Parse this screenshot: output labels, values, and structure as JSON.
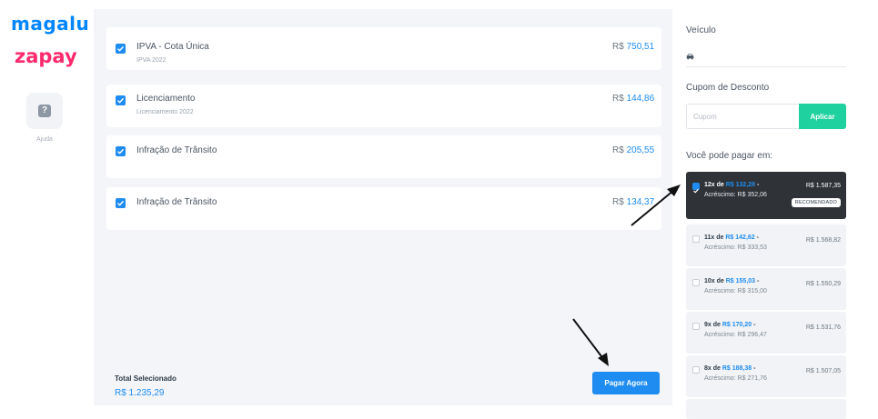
{
  "brand": {
    "magalu": "magalu",
    "zapay": "zapay",
    "magalu_color": "#0086ff",
    "zapay_color": "#ff2a6d"
  },
  "help": {
    "icon": "question-icon",
    "label": "Ajuda"
  },
  "debts": [
    {
      "title": "IPVA - Cota Única",
      "subtitle": "IPVA 2022",
      "currency": "R$",
      "amount": "750,51",
      "checked": true
    },
    {
      "title": "Licenciamento",
      "subtitle": "Licenciamento 2022",
      "currency": "R$",
      "amount": "144,86",
      "checked": true
    },
    {
      "title": "Infração de Trânsito",
      "subtitle": "",
      "currency": "R$",
      "amount": "205,55",
      "checked": true
    },
    {
      "title": "Infração de Trânsito",
      "subtitle": "",
      "currency": "R$",
      "amount": "134,37",
      "checked": true
    }
  ],
  "total": {
    "label": "Total Selecionado",
    "value": "R$ 1.235,29"
  },
  "pay_button": "Pagar Agora",
  "vehicle": {
    "label": "Veículo",
    "icon": "car-icon"
  },
  "coupon": {
    "label": "Cupom de Desconto",
    "placeholder": "Cupom",
    "button": "Aplicar"
  },
  "installments_label": "Você pode pagar em:",
  "installments": [
    {
      "prefix": "12x de",
      "value": "R$ 132,28",
      "suffix": " -",
      "extra": "Acréscimo: R$ 352,06",
      "total": "R$ 1.587,35",
      "selected": true,
      "badge": "RECOMENDADO"
    },
    {
      "prefix": "11x de",
      "value": "R$ 142,62",
      "suffix": " -",
      "extra": "Acréscimo: R$ 333,53",
      "total": "R$ 1.568,82",
      "selected": false
    },
    {
      "prefix": "10x de",
      "value": "R$ 155,03",
      "suffix": " -",
      "extra": "Acréscimo: R$ 315,00",
      "total": "R$ 1.550,29",
      "selected": false
    },
    {
      "prefix": "9x de",
      "value": "R$ 170,20",
      "suffix": " -",
      "extra": "Acréscimo: R$ 296,47",
      "total": "R$ 1.531,76",
      "selected": false
    },
    {
      "prefix": "8x de",
      "value": "R$ 188,38",
      "suffix": " -",
      "extra": "Acréscimo: R$ 271,76",
      "total": "R$ 1.507,05",
      "selected": false
    }
  ],
  "colors": {
    "accent": "#1e8cf0",
    "coupon_button": "#1fd19e",
    "selected_option": "#2f3338",
    "main_bg": "#f3f5f9"
  }
}
